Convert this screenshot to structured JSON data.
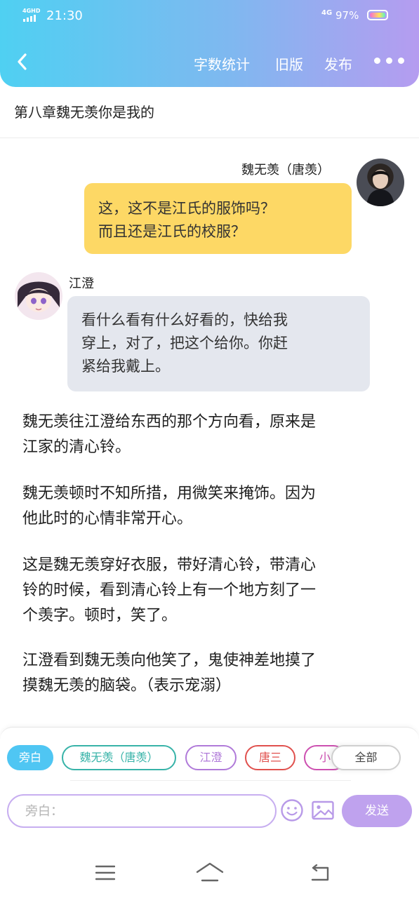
{
  "status_bar": {
    "network": "4GHD",
    "time": "21:30",
    "mobile_data": "4G",
    "battery_percent": "97%",
    "battery_level": 0.97
  },
  "header": {
    "back_icon": "chevron-left-icon",
    "actions": [
      {
        "label": "字数统计"
      },
      {
        "label": "旧版"
      },
      {
        "label": "发布"
      }
    ],
    "more_icon": "more-horizontal-icon"
  },
  "chapter": {
    "title": "第八章魏无羡你是我的"
  },
  "messages": [
    {
      "speaker": "魏无羡（唐羡）",
      "side": "right",
      "bubble_color": "#fdd865",
      "lines": [
        "这，这不是江氏的服饰吗？",
        "而且还是江氏的校服？"
      ]
    },
    {
      "speaker": "江澄",
      "side": "left",
      "bubble_color": "#e4e7ee",
      "lines": [
        "看什么看有什么好看的，快给我",
        "穿上，对了，把这个给你。你赶",
        "紧给我戴上。"
      ]
    }
  ],
  "narration": [
    {
      "lines": [
        "魏无羡往江澄给东西的那个方向看，原来是",
        "江家的清心铃。"
      ]
    },
    {
      "lines": [
        "魏无羡顿时不知所措，用微笑来掩饰。因为",
        "他此时的心情非常开心。"
      ]
    },
    {
      "lines": [
        "这是魏无羡穿好衣服，带好清心铃，带清心",
        "铃的时候，看到清心铃上有一个地方刻了一",
        "个羡字。顿时，笑了。"
      ]
    },
    {
      "lines": [
        "江澄看到魏无羡向他笑了，鬼使神差地摸了",
        "摸魏无羡的脑袋。（表示宠溺）"
      ]
    }
  ],
  "role_chips": [
    {
      "label": "旁白",
      "color": "#4fc6f3",
      "selected": true
    },
    {
      "label": "魏无羡（唐羡）",
      "color": "#37b3a8",
      "selected": false
    },
    {
      "label": "江澄",
      "color": "#b07ad9",
      "selected": false
    },
    {
      "label": "唐三",
      "color": "#e0504d",
      "selected": false
    },
    {
      "label": "小",
      "color": "#cc4fb0",
      "selected": false
    }
  ],
  "all_chip": {
    "label": "全部"
  },
  "composer": {
    "placeholder": "旁白：",
    "emoji_icon": "emoji-icon",
    "image_icon": "image-icon",
    "send_label": "发送"
  },
  "nav_bar": {
    "icons": [
      "menu-icon",
      "home-icon",
      "back-icon"
    ]
  },
  "colors": {
    "header_gradient": [
      "#4fd0f2",
      "#b59cf0"
    ],
    "accent_purple": "#bfa2ee",
    "accent_blue": "#4fc6f3"
  }
}
